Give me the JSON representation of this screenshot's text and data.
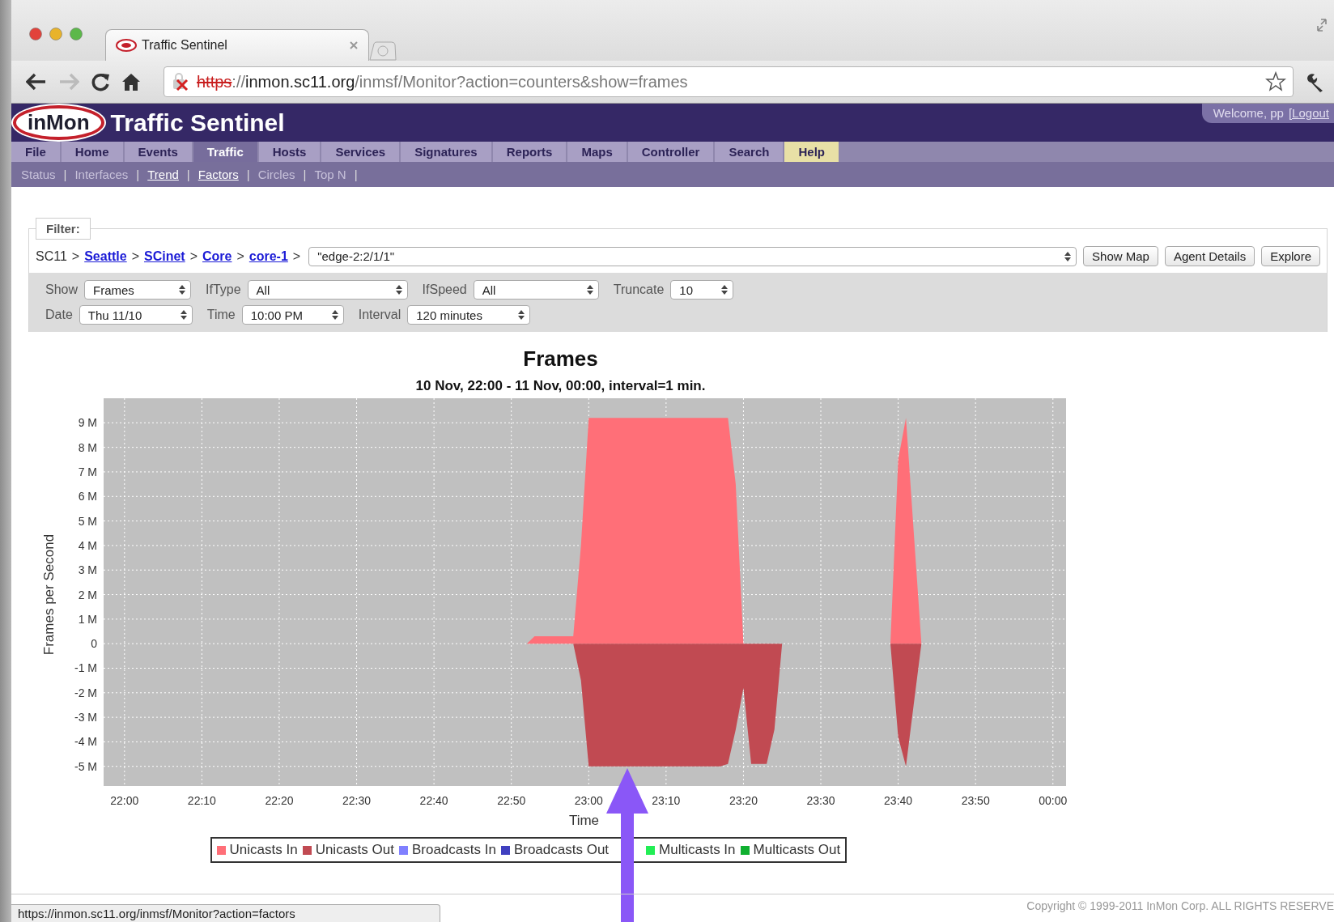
{
  "browser": {
    "tab": {
      "title": "Traffic Sentinel"
    },
    "url": {
      "scheme": "https",
      "separator": "://",
      "host": "inmon.sc11.org",
      "path": "/inmsf/Monitor?action=counters&show=frames"
    }
  },
  "header": {
    "logo": "inMon",
    "title": "Traffic Sentinel",
    "welcome": "Welcome, pp",
    "logout": "[Logout"
  },
  "nav": [
    {
      "label": "File",
      "selected": false,
      "highlighted": false
    },
    {
      "label": "Home",
      "selected": false,
      "highlighted": false
    },
    {
      "label": "Events",
      "selected": false,
      "highlighted": false
    },
    {
      "label": "Traffic",
      "selected": true,
      "highlighted": false
    },
    {
      "label": "Hosts",
      "selected": false,
      "highlighted": false
    },
    {
      "label": "Services",
      "selected": false,
      "highlighted": false
    },
    {
      "label": "Signatures",
      "selected": false,
      "highlighted": false
    },
    {
      "label": "Reports",
      "selected": false,
      "highlighted": false
    },
    {
      "label": "Maps",
      "selected": false,
      "highlighted": false
    },
    {
      "label": "Controller",
      "selected": false,
      "highlighted": false
    },
    {
      "label": "Search",
      "selected": false,
      "highlighted": false
    },
    {
      "label": "Help",
      "selected": false,
      "highlighted": true
    }
  ],
  "subnav": [
    {
      "label": "Status",
      "link": false,
      "separator": "|"
    },
    {
      "label": "Interfaces",
      "link": false,
      "separator": "|"
    },
    {
      "label": "Trend",
      "link": true,
      "separator": "|"
    },
    {
      "label": "Factors",
      "link": true,
      "separator": "|"
    },
    {
      "label": "Circles",
      "link": false,
      "separator": "|"
    },
    {
      "label": "Top N",
      "link": false,
      "separator": "|"
    }
  ],
  "filter": {
    "legend": "Filter:",
    "breadcrumb": [
      {
        "label": "SC11",
        "link": false,
        "separator": ">"
      },
      {
        "label": "Seattle",
        "link": true,
        "separator": ">"
      },
      {
        "label": "SCinet",
        "link": true,
        "separator": ">"
      },
      {
        "label": "Core",
        "link": true,
        "separator": ">"
      },
      {
        "label": "core-1",
        "link": true,
        "separator": ">"
      }
    ],
    "agent": "\"edge-2:2/1/1\"",
    "buttons": [
      "Show Map",
      "Agent Details",
      "Explore"
    ],
    "rows": [
      [
        {
          "label": "Show",
          "value": "Frames"
        },
        {
          "label": "IfType",
          "value": "All"
        },
        {
          "label": "IfSpeed",
          "value": "All"
        },
        {
          "label": "Truncate",
          "value": "10"
        }
      ],
      [
        {
          "label": "Date",
          "value": "Thu 11/10"
        },
        {
          "label": "Time",
          "value": "10:00 PM"
        },
        {
          "label": "Interval",
          "value": "120 minutes"
        }
      ]
    ]
  },
  "chart": {
    "chart_data": {
      "type": "area",
      "title": "Frames",
      "subtitle": "10 Nov, 22:00 -  11 Nov, 00:00, interval=1 min.",
      "xlabel": "Time",
      "ylabel": "Frames per Second",
      "grid": true,
      "categories": [
        "22:00",
        null,
        null,
        null,
        null,
        null,
        null,
        null,
        null,
        null,
        "22:10",
        null,
        null,
        null,
        null,
        null,
        null,
        null,
        null,
        null,
        "22:20",
        null,
        null,
        null,
        null,
        null,
        null,
        null,
        null,
        null,
        "22:30",
        null,
        null,
        null,
        null,
        null,
        null,
        null,
        null,
        null,
        "22:40",
        null,
        null,
        null,
        null,
        null,
        null,
        null,
        null,
        null,
        "22:50",
        null,
        null,
        null,
        null,
        null,
        null,
        null,
        null,
        null,
        "23:00",
        null,
        null,
        null,
        null,
        null,
        null,
        null,
        null,
        null,
        "23:10",
        null,
        null,
        null,
        null,
        null,
        null,
        null,
        null,
        null,
        "23:20",
        null,
        null,
        null,
        null,
        null,
        null,
        null,
        null,
        null,
        "23:30",
        null,
        null,
        null,
        null,
        null,
        null,
        null,
        null,
        null,
        "23:40",
        null,
        null,
        null,
        null,
        null,
        null,
        null,
        null,
        null,
        "23:50",
        null,
        null,
        null,
        null,
        null,
        null,
        null,
        null,
        null,
        "00:00"
      ],
      "series": [
        {
          "name": "Unicasts In",
          "color": "#ff6f78",
          "values": [
            0,
            0,
            0,
            0,
            0,
            0,
            0,
            0,
            0,
            0,
            0,
            0,
            0,
            0,
            0,
            0,
            0,
            0,
            0,
            0,
            0,
            0,
            0,
            0,
            0,
            0,
            0,
            0,
            0,
            0,
            0,
            0,
            0,
            0,
            0,
            0,
            0,
            0,
            0,
            0,
            0,
            0,
            0,
            0,
            0,
            0,
            0,
            0,
            0,
            0,
            0,
            0,
            0,
            0.3,
            0.3,
            0.3,
            0.3,
            0.3,
            0.3,
            4,
            9.2,
            9.2,
            9.2,
            9.2,
            9.2,
            9.2,
            9.2,
            9.2,
            9.2,
            9.2,
            9.2,
            9.2,
            9.2,
            9.2,
            9.2,
            9.2,
            9.2,
            9.2,
            9.2,
            6.5,
            0,
            0,
            0,
            0,
            0,
            0,
            0,
            0,
            0,
            0,
            0,
            0,
            0,
            0,
            0,
            0,
            0,
            0,
            0,
            0,
            7.5,
            9.2,
            4.6,
            0,
            0,
            0,
            0,
            0,
            0,
            0,
            0,
            0,
            0,
            0,
            0,
            0,
            0,
            0,
            0,
            0,
            0
          ]
        },
        {
          "name": "Unicasts Out",
          "color": "#c14a52",
          "values": [
            0,
            0,
            0,
            0,
            0,
            0,
            0,
            0,
            0,
            0,
            0,
            0,
            0,
            0,
            0,
            0,
            0,
            0,
            0,
            0,
            0,
            0,
            0,
            0,
            0,
            0,
            0,
            0,
            0,
            0,
            0,
            0,
            0,
            0,
            0,
            0,
            0,
            0,
            0,
            0,
            0,
            0,
            0,
            0,
            0,
            0,
            0,
            0,
            0,
            0,
            0,
            0,
            0,
            0,
            0,
            0,
            0,
            0,
            0,
            -1.5,
            -5,
            -5,
            -5,
            -5,
            -5,
            -5,
            -5,
            -5,
            -5,
            -5,
            -5,
            -5,
            -5,
            -5,
            -5,
            -5,
            -5,
            -5,
            -4.9,
            -3.5,
            -1.8,
            -4.9,
            -4.9,
            -4.9,
            -3.5,
            0,
            0,
            0,
            0,
            0,
            0,
            0,
            0,
            0,
            0,
            0,
            0,
            0,
            0,
            0,
            -3.8,
            -5,
            -2.5,
            0,
            0,
            0,
            0,
            0,
            0,
            0,
            0,
            0,
            0,
            0,
            0,
            0,
            0,
            0,
            0,
            0,
            0
          ]
        },
        {
          "name": "Broadcasts In",
          "color": "#8080ff",
          "values": [
            null,
            null,
            null,
            null,
            null,
            null,
            null,
            null,
            null,
            null,
            null,
            null,
            null,
            null,
            null,
            null,
            null,
            null,
            null,
            null,
            null,
            null,
            null,
            null,
            null,
            null,
            null,
            null,
            null,
            null,
            null,
            null,
            null,
            null,
            null,
            null,
            null,
            null,
            null,
            null,
            null,
            null,
            null,
            null,
            null,
            null,
            null,
            null,
            null,
            null,
            null,
            null,
            null,
            null,
            null,
            null,
            null,
            null,
            null,
            null,
            null,
            null,
            null,
            null,
            null,
            null,
            null,
            null,
            null,
            null,
            null,
            null,
            null,
            null,
            null,
            null,
            null,
            null,
            null,
            null,
            null,
            null,
            null,
            null,
            null,
            null,
            null,
            null,
            null,
            null,
            null,
            null,
            null,
            null,
            null,
            null,
            null,
            null,
            null,
            null,
            null,
            null,
            null,
            null,
            null,
            null,
            null,
            null,
            null,
            null,
            null,
            null,
            null,
            null,
            null,
            null,
            null,
            null,
            null,
            null,
            null
          ]
        },
        {
          "name": "Broadcasts Out",
          "color": "#4040c0",
          "values": [
            null,
            null,
            null,
            null,
            null,
            null,
            null,
            null,
            null,
            null,
            null,
            null,
            null,
            null,
            null,
            null,
            null,
            null,
            null,
            null,
            null,
            null,
            null,
            null,
            null,
            null,
            null,
            null,
            null,
            null,
            null,
            null,
            null,
            null,
            null,
            null,
            null,
            null,
            null,
            null,
            null,
            null,
            null,
            null,
            null,
            null,
            null,
            null,
            null,
            null,
            null,
            null,
            null,
            null,
            null,
            null,
            null,
            null,
            null,
            null,
            null,
            null,
            null,
            null,
            null,
            null,
            null,
            null,
            null,
            null,
            null,
            null,
            null,
            null,
            null,
            null,
            null,
            null,
            null,
            null,
            null,
            null,
            null,
            null,
            null,
            null,
            null,
            null,
            null,
            null,
            null,
            null,
            null,
            null,
            null,
            null,
            null,
            null,
            null,
            null,
            null,
            null,
            null,
            null,
            null,
            null,
            null,
            null,
            null,
            null,
            null,
            null,
            null,
            null,
            null,
            null,
            null,
            null,
            null,
            null,
            null
          ]
        },
        {
          "name": "Multicasts In",
          "color": "#22ee55",
          "values": [
            null,
            null,
            null,
            null,
            null,
            null,
            null,
            null,
            null,
            null,
            null,
            null,
            null,
            null,
            null,
            null,
            null,
            null,
            null,
            null,
            null,
            null,
            null,
            null,
            null,
            null,
            null,
            null,
            null,
            null,
            null,
            null,
            null,
            null,
            null,
            null,
            null,
            null,
            null,
            null,
            null,
            null,
            null,
            null,
            null,
            null,
            null,
            null,
            null,
            null,
            null,
            null,
            null,
            null,
            null,
            null,
            null,
            null,
            null,
            null,
            null,
            null,
            null,
            null,
            null,
            null,
            null,
            null,
            null,
            null,
            null,
            null,
            null,
            null,
            null,
            null,
            null,
            null,
            null,
            null,
            null,
            null,
            null,
            null,
            null,
            null,
            null,
            null,
            null,
            null,
            null,
            null,
            null,
            null,
            null,
            null,
            null,
            null,
            null,
            null,
            null,
            null,
            null,
            null,
            null,
            null,
            null,
            null,
            null,
            null,
            null,
            null,
            null,
            null,
            null,
            null,
            null,
            null,
            null,
            null,
            null
          ]
        },
        {
          "name": "Multicasts Out",
          "color": "#10b030",
          "values": [
            null,
            null,
            null,
            null,
            null,
            null,
            null,
            null,
            null,
            null,
            null,
            null,
            null,
            null,
            null,
            null,
            null,
            null,
            null,
            null,
            null,
            null,
            null,
            null,
            null,
            null,
            null,
            null,
            null,
            null,
            null,
            null,
            null,
            null,
            null,
            null,
            null,
            null,
            null,
            null,
            null,
            null,
            null,
            null,
            null,
            null,
            null,
            null,
            null,
            null,
            null,
            null,
            null,
            null,
            null,
            null,
            null,
            null,
            null,
            null,
            null,
            null,
            null,
            null,
            null,
            null,
            null,
            null,
            null,
            null,
            null,
            null,
            null,
            null,
            null,
            null,
            null,
            null,
            null,
            null,
            null,
            null,
            null,
            null,
            null,
            null,
            null,
            null,
            null,
            null,
            null,
            null,
            null,
            null,
            null,
            null,
            null,
            null,
            null,
            null,
            null,
            null,
            null,
            null,
            null,
            null,
            null,
            null,
            null,
            null,
            null,
            null,
            null,
            null,
            null,
            null,
            null,
            null,
            null,
            null,
            null
          ]
        }
      ],
      "ylim": [
        -5.8,
        10
      ],
      "yticks": [
        {
          "value": 9,
          "label": "9 M"
        },
        {
          "value": 8,
          "label": "8 M"
        },
        {
          "value": 7,
          "label": "7 M"
        },
        {
          "value": 6,
          "label": "6 M"
        },
        {
          "value": 5,
          "label": "5 M"
        },
        {
          "value": 4,
          "label": "4 M"
        },
        {
          "value": 3,
          "label": "3 M"
        },
        {
          "value": 2,
          "label": "2 M"
        },
        {
          "value": 1,
          "label": "1 M"
        },
        {
          "value": 0,
          "label": "0"
        },
        {
          "value": -1,
          "label": "-1 M"
        },
        {
          "value": -2,
          "label": "-2 M"
        },
        {
          "value": -3,
          "label": "-3 M"
        },
        {
          "value": -4,
          "label": "-4 M"
        },
        {
          "value": -5,
          "label": "-5 M"
        }
      ]
    }
  },
  "copyright": "Copyright © 1999-2011 InMon Corp. ALL RIGHTS RESERVE",
  "status_bar": "https://inmon.sc11.org/inmsf/Monitor?action=factors"
}
